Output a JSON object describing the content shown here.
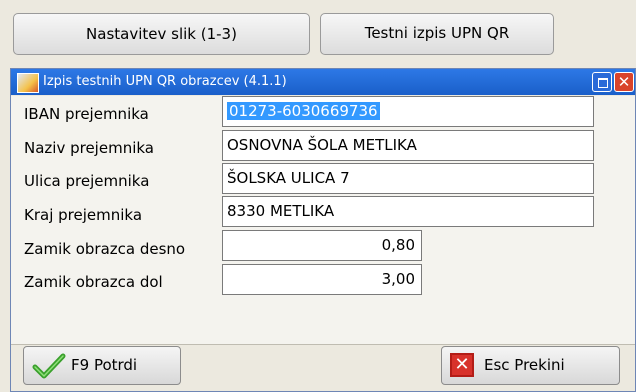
{
  "toolbar": {
    "nastavitev_label": "Nastavitev slik (1-3)",
    "testni_label": "Testni izpis UPN QR"
  },
  "dialog": {
    "title": "Izpis testnih UPN QR obrazcev  (4.1.1)",
    "fields": {
      "iban": {
        "label": "IBAN prejemnika",
        "value": "01273-6030669736"
      },
      "naziv": {
        "label": "Naziv prejemnika",
        "value": "OSNOVNA ŠOLA METLIKA"
      },
      "ulica": {
        "label": "Ulica prejemnika",
        "value": "ŠOLSKA ULICA 7"
      },
      "kraj": {
        "label": "Kraj prejemnika",
        "value": "8330 METLIKA"
      },
      "zamik_desno": {
        "label": "Zamik obrazca desno",
        "value": "0,80"
      },
      "zamik_dol": {
        "label": "Zamik obrazca dol",
        "value": "3,00"
      }
    },
    "buttons": {
      "potrdi_label": "F9 Potrdi",
      "prekini_label": "Esc Prekini"
    },
    "titlebar_buttons": {
      "close_glyph": "✕"
    }
  },
  "colors": {
    "titlebar": "#1f66d6",
    "selection": "#3399ff",
    "close": "#d9432b"
  }
}
